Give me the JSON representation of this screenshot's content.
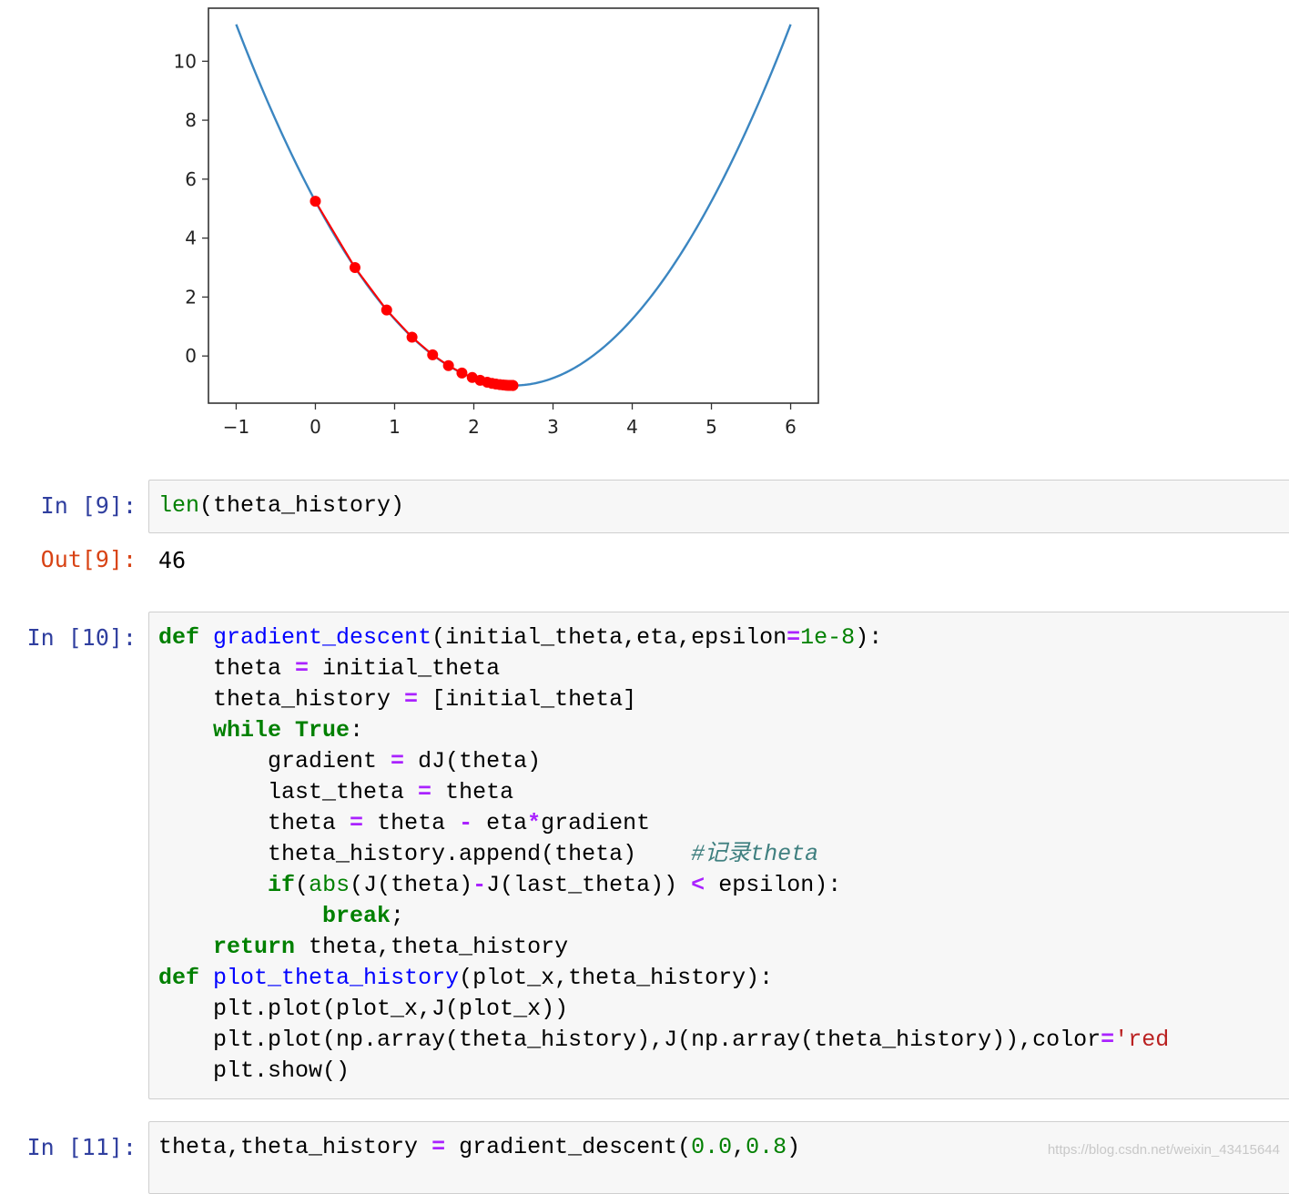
{
  "chart_data": {
    "type": "line",
    "series": [
      {
        "kind": "line",
        "color": "#3b86c1",
        "function": "(x-2.5)^2 - 1",
        "x_range": [
          -1,
          6
        ]
      },
      {
        "kind": "scatter",
        "color": "#ff0000",
        "x": [
          0.0,
          0.5,
          0.9,
          1.22,
          1.48,
          1.68,
          1.85,
          1.98,
          2.08,
          2.17,
          2.23,
          2.28,
          2.33,
          2.37,
          2.4,
          2.42,
          2.44,
          2.45,
          2.46,
          2.47,
          2.48,
          2.485,
          2.49,
          2.492,
          2.494
        ]
      }
    ],
    "xlim": [
      -1.35,
      6.35
    ],
    "ylim": [
      -1.6,
      11.8
    ],
    "xticks": [
      "−1",
      "0",
      "1",
      "2",
      "3",
      "4",
      "5",
      "6"
    ],
    "yticks": [
      "0",
      "2",
      "4",
      "6",
      "8",
      "10"
    ],
    "xtick_values": [
      -1,
      0,
      1,
      2,
      3,
      4,
      5,
      6
    ],
    "ytick_values": [
      0,
      2,
      4,
      6,
      8,
      10
    ],
    "grid": false
  },
  "cells": {
    "c9": {
      "prompt": "In [9]:",
      "code": "len(theta_history)"
    },
    "o9": {
      "prompt": "Out[9]:",
      "value": "46"
    },
    "c10": {
      "prompt": "In [10]:"
    },
    "c11": {
      "prompt": "In [11]:"
    }
  },
  "code10_comment": "#记录theta",
  "code10_string": "'red",
  "code11_nums": [
    "0.0",
    "0.8"
  ],
  "watermark": "https://blog.csdn.net/weixin_43415644"
}
